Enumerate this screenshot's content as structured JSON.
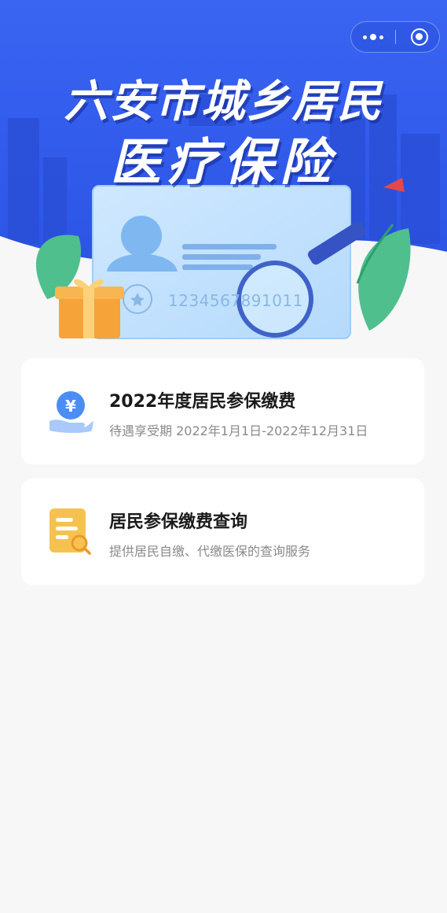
{
  "banner": {
    "title_line1": "六安市城乡居民",
    "title_line2": "医疗保险",
    "card_number": "1234567891011"
  },
  "capsule": {
    "more_icon": "more-dots-icon",
    "close_icon": "target-close-icon"
  },
  "menu": [
    {
      "title": "2022年度居民参保缴费",
      "subtitle": "待遇享受期 2022年1月1日-2022年12月31日",
      "icon": "yuan-hand-icon"
    },
    {
      "title": "居民参保缴费查询",
      "subtitle": "提供居民自缴、代缴医保的查询服务",
      "icon": "document-search-icon"
    }
  ],
  "colors": {
    "banner_blue": "#2f5ef0",
    "page_bg": "#f7f7f7",
    "card_bg": "#ffffff",
    "title_text": "#1a1a1a",
    "sub_text": "#8a8a8a",
    "icon_blue": "#4a8ef5",
    "icon_yellow": "#f6c24f"
  }
}
